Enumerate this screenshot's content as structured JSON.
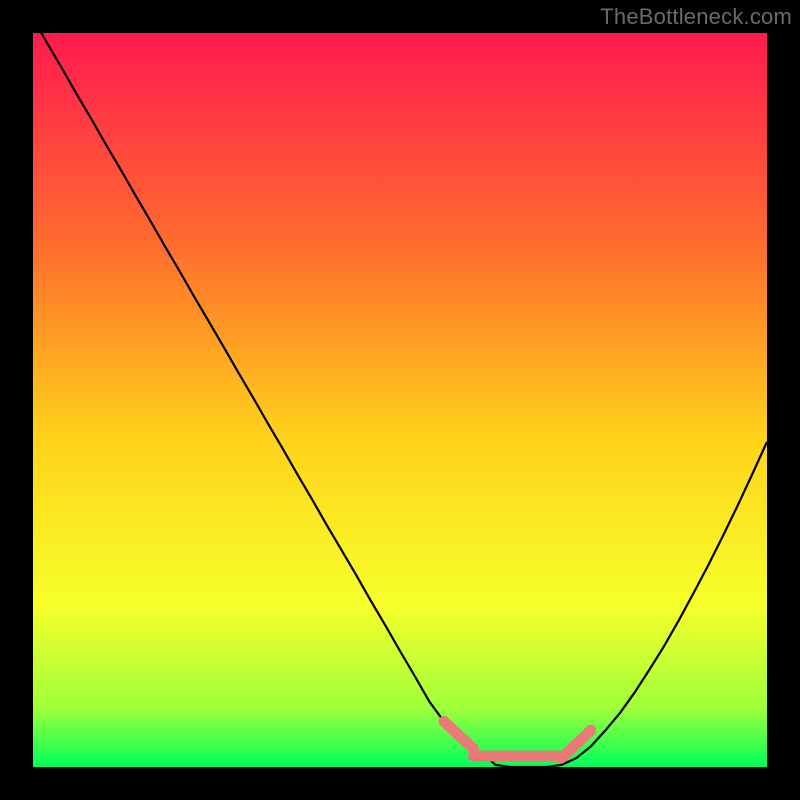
{
  "watermark": "TheBottleneck.com",
  "palette": {
    "frame_bg": "#000000",
    "grad_top": "#ff1a4f",
    "grad_q1": "#ff6a2f",
    "grad_mid": "#ffd21a",
    "grad_q3": "#f6ff2a",
    "grad_low": "#9fff3a",
    "grad_bot": "#00ff5a",
    "curve": "#000000",
    "segment": "#e97a77"
  },
  "chart_data": {
    "type": "line",
    "title": "",
    "xlabel": "",
    "ylabel": "",
    "x": [
      0.0,
      0.02,
      0.04,
      0.06,
      0.08,
      0.1,
      0.12,
      0.14,
      0.16,
      0.18,
      0.2,
      0.22,
      0.24,
      0.26,
      0.28,
      0.3,
      0.32,
      0.34,
      0.36,
      0.38,
      0.4,
      0.42,
      0.44,
      0.46,
      0.48,
      0.5,
      0.52,
      0.54,
      0.56,
      0.58,
      0.6,
      0.62,
      0.63,
      0.65,
      0.68,
      0.7,
      0.72,
      0.74,
      0.76,
      0.78,
      0.8,
      0.82,
      0.84,
      0.86,
      0.88,
      0.9,
      0.92,
      0.94,
      0.96,
      0.98,
      1.0
    ],
    "values": [
      1.02,
      0.985,
      0.951,
      0.916,
      0.882,
      0.847,
      0.813,
      0.778,
      0.744,
      0.709,
      0.675,
      0.64,
      0.606,
      0.572,
      0.537,
      0.503,
      0.468,
      0.434,
      0.399,
      0.365,
      0.33,
      0.296,
      0.262,
      0.227,
      0.193,
      0.158,
      0.124,
      0.089,
      0.062,
      0.04,
      0.025,
      0.012,
      0.003,
      0.0,
      0.0,
      0.0,
      0.003,
      0.012,
      0.028,
      0.05,
      0.074,
      0.102,
      0.133,
      0.165,
      0.2,
      0.237,
      0.275,
      0.315,
      0.356,
      0.399,
      0.443
    ],
    "highlight_segments": [
      {
        "x_start": 0.56,
        "x_end": 0.6,
        "y_start": 0.062,
        "y_end": 0.025
      },
      {
        "x_start": 0.6,
        "x_end": 0.72,
        "y_start": 0.015,
        "y_end": 0.015
      },
      {
        "x_start": 0.72,
        "x_end": 0.76,
        "y_start": 0.012,
        "y_end": 0.05
      }
    ],
    "xlim": [
      0,
      1
    ],
    "ylim": [
      0,
      1
    ],
    "grid": false,
    "legend": false
  }
}
